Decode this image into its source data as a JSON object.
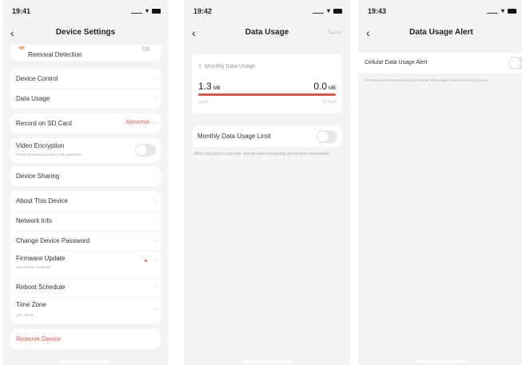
{
  "screen1": {
    "time": "19:41",
    "title": "Device Settings",
    "partial_row_label": "Removal Detection",
    "partial_row_value": "Off",
    "device_control": "Device Control",
    "data_usage": "Data Usage",
    "sd_label": "Record on SD Card",
    "sd_value": "Abnormal",
    "video_encryption": "Video Encryption",
    "video_encryption_sub": "Protect photos and videos with password",
    "device_sharing": "Device Sharing",
    "about": "About This Device",
    "network_info": "Network Info",
    "change_password": "Change Device Password",
    "firmware": "Firmware Update",
    "firmware_sub": "New version available",
    "reboot": "Reboot Schedule",
    "time_zone": "Time Zone",
    "time_zone_value": "UTC-10:00",
    "remove": "Remove Device"
  },
  "screen2": {
    "time": "19:42",
    "title": "Data Usage",
    "save": "Save",
    "monthly_title": "Monthly Data Usage",
    "used_value": "1.3",
    "used_unit": "MB",
    "total_value": "0.0",
    "total_unit": "MB",
    "used_label": "Used",
    "total_label": "In Total",
    "usage_fraction": 1.0,
    "limit_label": "Monthly Data Usage Limit",
    "limit_note": "When data limit is reached, remote video monitoring will become unavailable."
  },
  "screen3": {
    "time": "19:43",
    "title": "Data Usage Alert",
    "alert_label": "Cellular Data Usage Alert",
    "alert_note": "You will receive alerts when your cellular data usage reaches the limit you set."
  },
  "colors": {
    "accent_red": "#e0564a",
    "dot_orange": "#e8702a",
    "background": "#f4f4f6"
  },
  "icons": {
    "back": "chevron-left-icon",
    "row_arrow": "chevron-right-icon",
    "chart": "chart-icon"
  }
}
